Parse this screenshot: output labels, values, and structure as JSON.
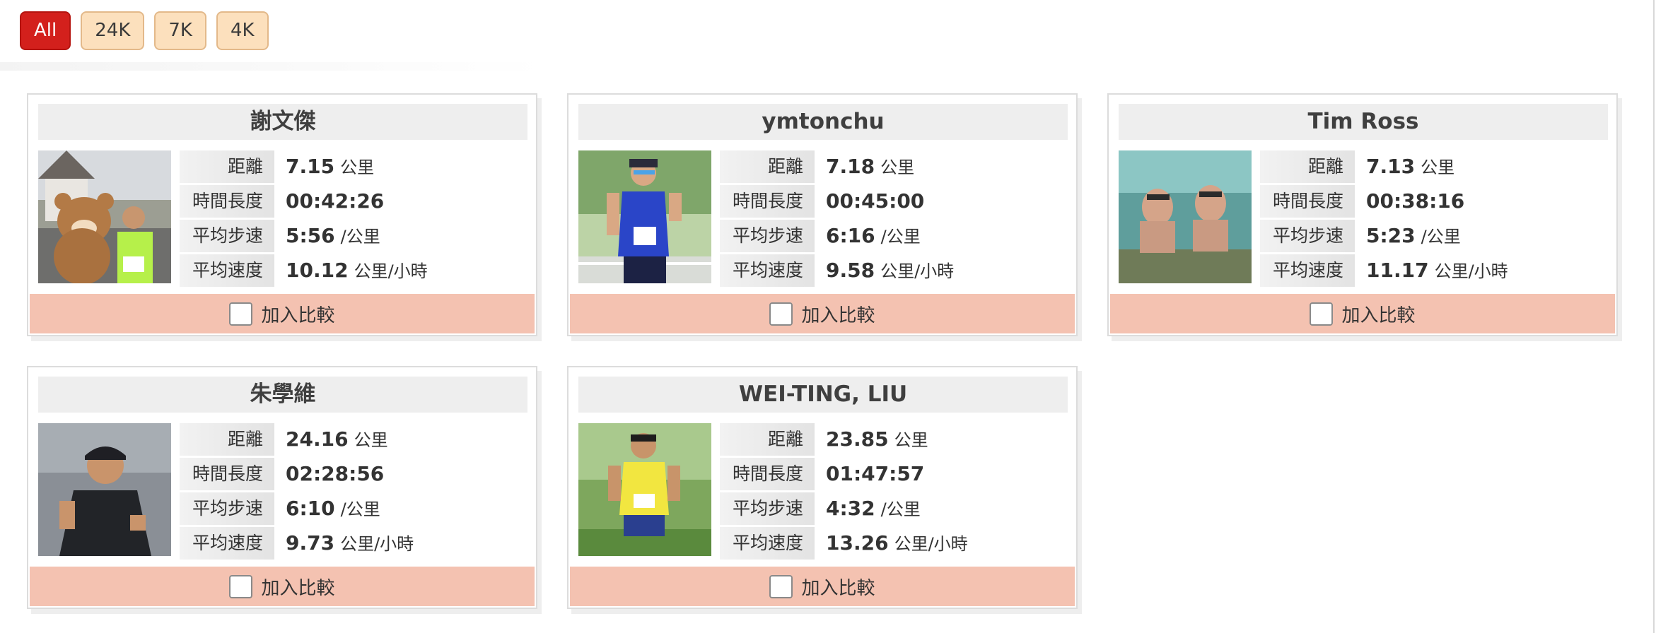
{
  "filters": [
    {
      "label": "All",
      "active": true
    },
    {
      "label": "24K",
      "active": false
    },
    {
      "label": "7K",
      "active": false
    },
    {
      "label": "4K",
      "active": false
    }
  ],
  "labels": {
    "distance": "距離",
    "duration": "時間長度",
    "pace": "平均步速",
    "speed": "平均速度",
    "compare": "加入比較"
  },
  "units": {
    "distance": "公里",
    "pace": "/公里",
    "speed": "公里/小時"
  },
  "runners": [
    {
      "name": "謝文傑",
      "distance": "7.15",
      "duration": "00:42:26",
      "pace": "5:56",
      "speed": "10.12",
      "photo": "mascot-runner-photo"
    },
    {
      "name": "ymtonchu",
      "distance": "7.18",
      "duration": "00:45:00",
      "pace": "6:16",
      "speed": "9.58",
      "photo": "runner-bib-photo"
    },
    {
      "name": "Tim Ross",
      "distance": "7.13",
      "duration": "00:38:16",
      "pace": "5:23",
      "speed": "11.17",
      "photo": "underwater-photo"
    },
    {
      "name": "朱學維",
      "distance": "24.16",
      "duration": "02:28:56",
      "pace": "6:10",
      "speed": "9.73",
      "photo": "runner-thumbsup-photo"
    },
    {
      "name": "WEI-TING, LIU",
      "distance": "23.85",
      "duration": "01:47:57",
      "pace": "4:32",
      "speed": "13.26",
      "photo": "runner-yellow-shirt-photo"
    }
  ]
}
